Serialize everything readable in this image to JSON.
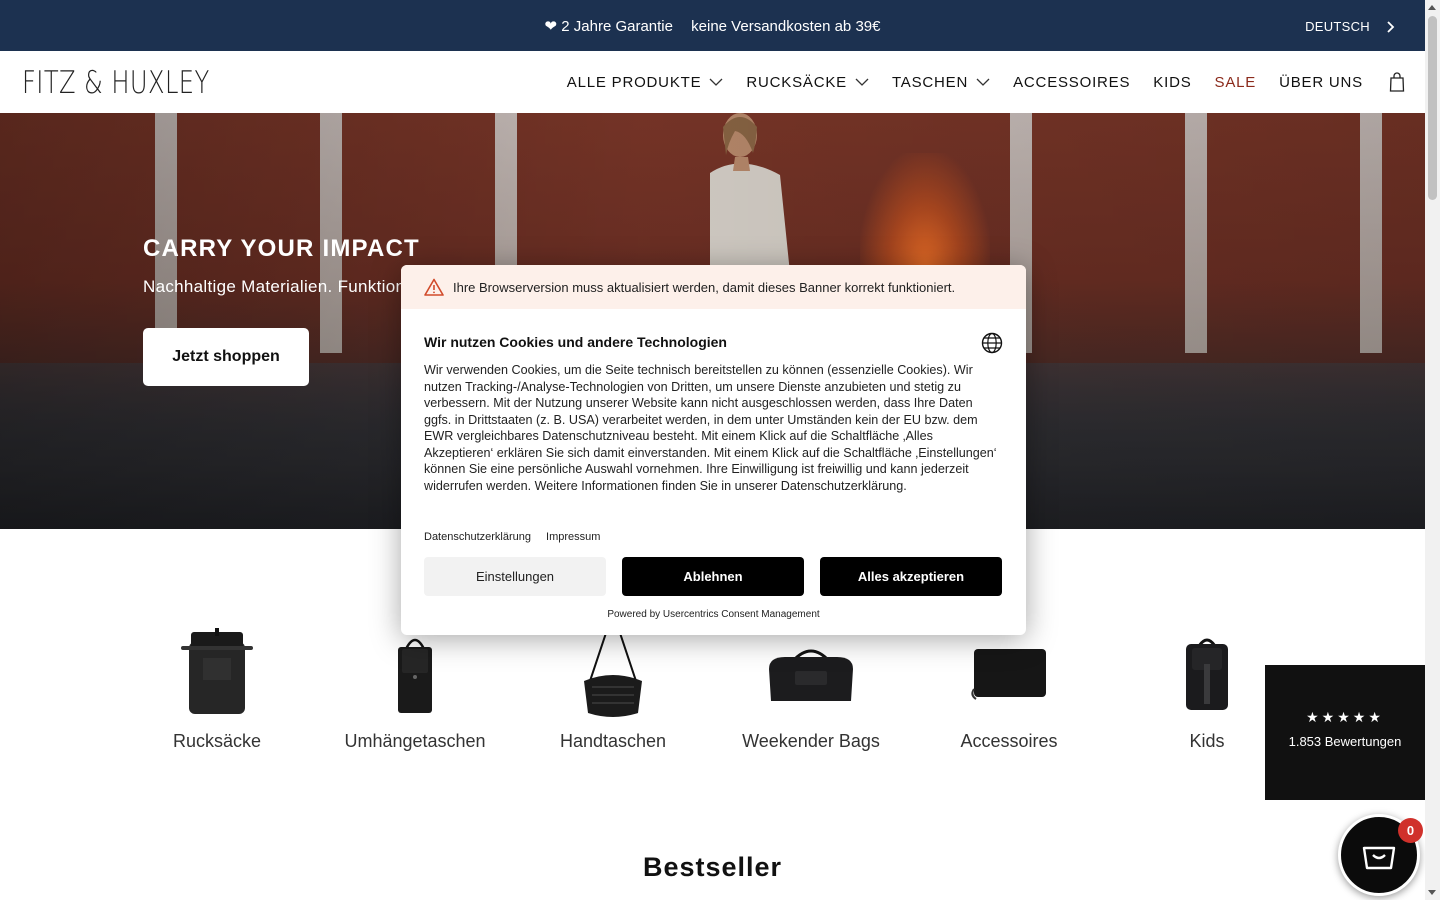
{
  "announcement": {
    "message_1": "❤ 2 Jahre Garantie",
    "message_2": "keine Versandkosten ab 39€",
    "language": "DEUTSCH"
  },
  "header": {
    "logo": "FITZ & HUXLEY",
    "nav": [
      {
        "label": "ALLE PRODUKTE",
        "dropdown": true
      },
      {
        "label": "RUCKSÄCKE",
        "dropdown": true
      },
      {
        "label": "TASCHEN",
        "dropdown": true
      },
      {
        "label": "ACCESSOIRES",
        "dropdown": false
      },
      {
        "label": "KIDS",
        "dropdown": false
      },
      {
        "label": "SALE",
        "dropdown": false
      },
      {
        "label": "ÜBER UNS",
        "dropdown": false
      }
    ]
  },
  "hero": {
    "title": "CARRY YOUR IMPACT",
    "subtitle": "Nachhaltige Materialien. Funktiona",
    "cta": "Jetzt shoppen"
  },
  "categories": [
    {
      "label": "Rucksäcke",
      "icon": "rolltop-backpack"
    },
    {
      "label": "Umhängetaschen",
      "icon": "crossbody-bag"
    },
    {
      "label": "Handtaschen",
      "icon": "handbag"
    },
    {
      "label": "Weekender Bags",
      "icon": "duffel-bag"
    },
    {
      "label": "Accessoires",
      "icon": "laptop-sleeve"
    },
    {
      "label": "Kids",
      "icon": "kids-backpack"
    }
  ],
  "section": {
    "bestseller": "Bestseller"
  },
  "reviews": {
    "stars": "★★★★★",
    "rating": 4.5,
    "count_label": "1.853 Bewertungen"
  },
  "cart": {
    "count": "0"
  },
  "cookie": {
    "warning": "Ihre Browserversion muss aktualisiert werden, damit dieses Banner korrekt funktioniert.",
    "title": "Wir nutzen Cookies und andere Technologien",
    "body": "Wir verwenden Cookies, um die Seite technisch bereitstellen zu können (essenzielle Cookies). Wir nutzen Tracking-/Analyse-Technologien von Dritten, um unsere Dienste anzubieten und stetig zu verbessern. Mit der Nutzung unserer Website kann nicht ausgeschlossen werden, dass Ihre Daten ggfs. in Drittstaaten (z. B. USA) verarbeitet werden, in dem unter Umständen kein der EU bzw. dem EWR vergleichbares Datenschutzniveau besteht. Mit einem Klick auf die Schaltfläche ‚Alles Akzeptieren‘ erklären Sie sich damit einverstanden. Mit einem Klick auf die Schaltfläche ‚Einstellungen‘ können Sie eine persönliche Auswahl vornehmen. Ihre Einwilligung ist freiwillig und kann jederzeit widerrufen werden. Weitere Informationen finden Sie in unserer Datenschutzerklärung.",
    "link_privacy": "Datenschutzerklärung",
    "link_imprint": "Impressum",
    "btn_settings": "Einstellungen",
    "btn_decline": "Ablehnen",
    "btn_accept": "Alles akzeptieren",
    "powered": "Powered by Usercentrics Consent Management"
  },
  "colors": {
    "announcement_bg": "#1c3150",
    "sale": "#8b2a1b",
    "warning_bg": "#fdf0ea",
    "badge": "#d0312b"
  }
}
